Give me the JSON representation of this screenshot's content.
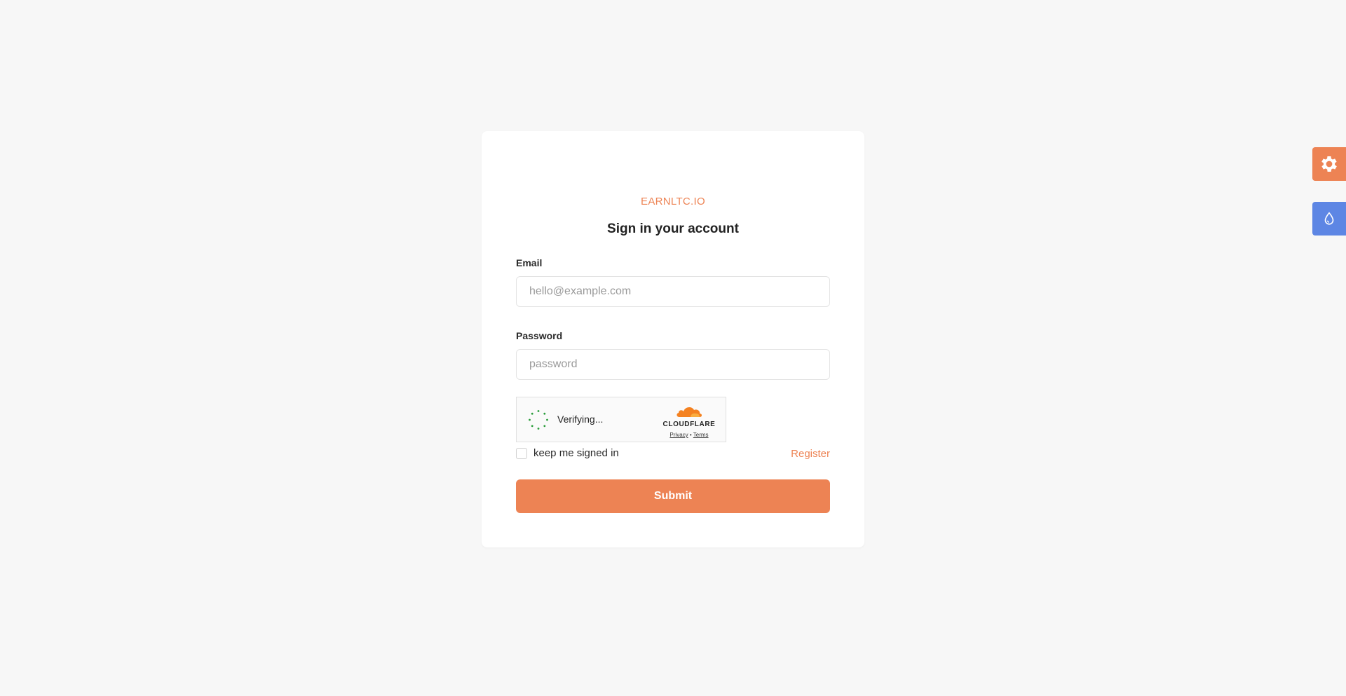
{
  "colors": {
    "accent": "#ed8354",
    "blue": "#5d86e4",
    "page_bg": "#f7f7f7",
    "spinner": "#2a9d3b"
  },
  "card": {
    "brand": "EARNLTC.IO",
    "title": "Sign in your account"
  },
  "form": {
    "email": {
      "label": "Email",
      "placeholder": "hello@example.com",
      "value": ""
    },
    "password": {
      "label": "Password",
      "placeholder": "password",
      "value": ""
    },
    "remember_label": "keep me signed in",
    "register_label": "Register",
    "submit_label": "Submit"
  },
  "turnstile": {
    "status": "Verifying...",
    "brand": "CLOUDFLARE",
    "privacy": "Privacy",
    "separator": "•",
    "terms": "Terms"
  },
  "side_buttons": [
    {
      "icon": "gear-icon",
      "color": "#ed8354"
    },
    {
      "icon": "droplet-icon",
      "color": "#5d86e4"
    }
  ]
}
